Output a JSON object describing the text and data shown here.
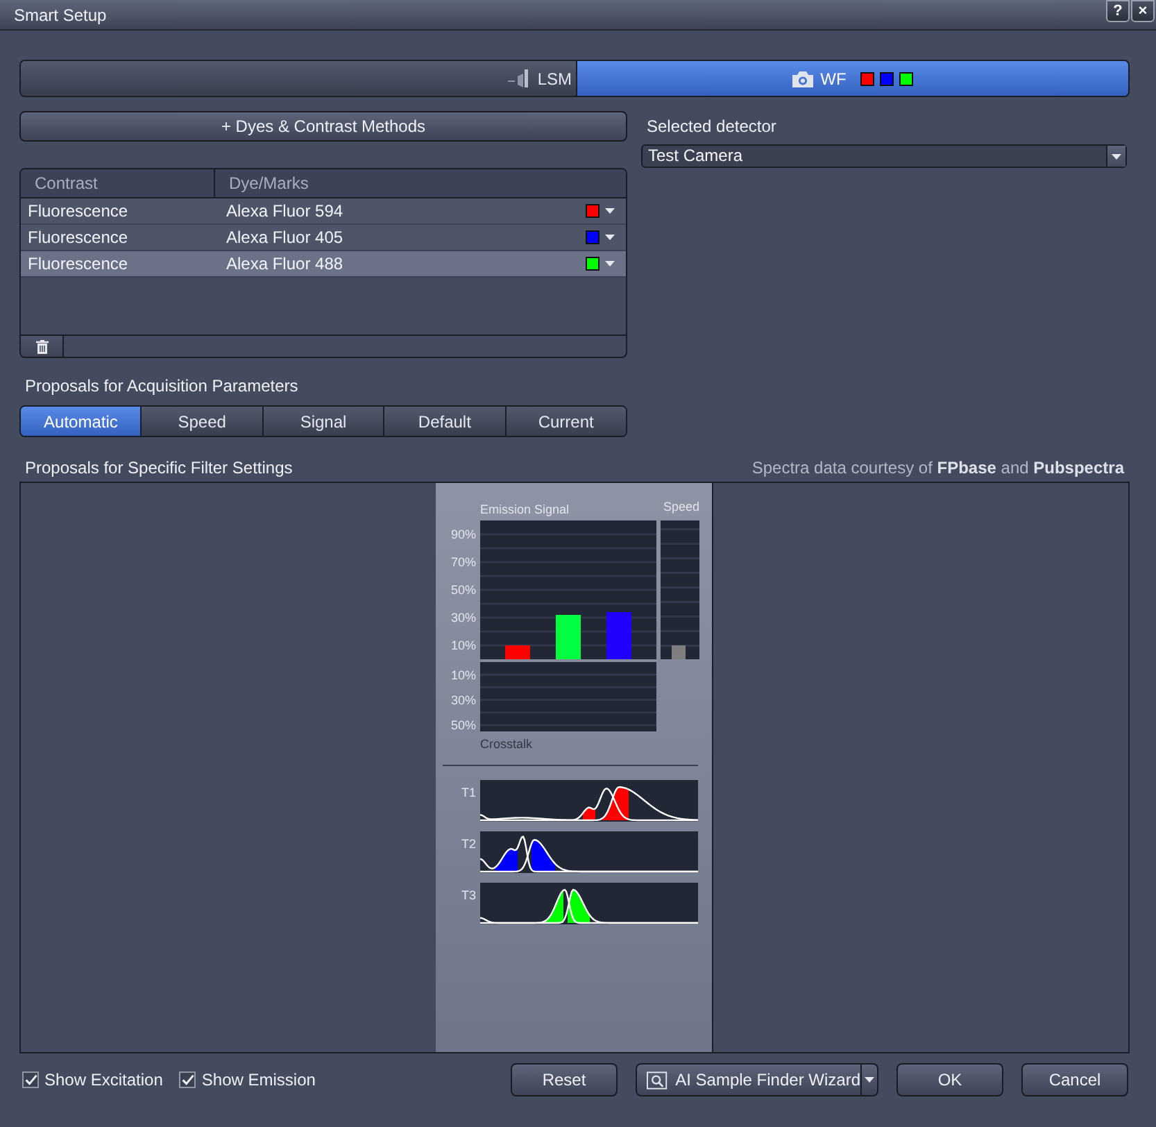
{
  "window": {
    "title": "Smart Setup",
    "title_buttons": [
      "?",
      "×"
    ]
  },
  "modes": [
    {
      "label": "LSM",
      "selected": false,
      "kind": "lsm"
    },
    {
      "label": "WF",
      "selected": true,
      "kind": "camera",
      "swatches": [
        {
          "color": "#ff0000"
        },
        {
          "color": "#0000ff"
        },
        {
          "color": "#00ff00"
        }
      ]
    }
  ],
  "add_button": {
    "label": "+ Dyes & Contrast Methods"
  },
  "detector": {
    "label": "Selected detector",
    "value": "Test Camera"
  },
  "dyes_table": {
    "columns": [
      "Contrast",
      "Dye/Marks"
    ],
    "rows": [
      {
        "contrast": "Fluorescence",
        "dye": "Alexa Fluor 594",
        "color": "#ff0000",
        "selected": false
      },
      {
        "contrast": "Fluorescence",
        "dye": "Alexa Fluor 405",
        "color": "#0000ff",
        "selected": false
      },
      {
        "contrast": "Fluorescence",
        "dye": "Alexa Fluor 488",
        "color": "#00ff00",
        "selected": true
      }
    ]
  },
  "acquisition": {
    "title": "Proposals for Acquisition Parameters",
    "options": [
      {
        "label": "Automatic",
        "selected": true
      },
      {
        "label": "Speed",
        "selected": false
      },
      {
        "label": "Signal",
        "selected": false
      },
      {
        "label": "Default",
        "selected": false
      },
      {
        "label": "Current",
        "selected": false
      }
    ]
  },
  "filter_settings": {
    "title": "Proposals for Specific Filter Settings",
    "credit": "Spectra data courtesy of **FPbase** and **Pubspectra**",
    "emission_chart": {
      "chart_data": {
        "type": "bar",
        "title": "Emission Signal",
        "categories": [
          null,
          null,
          null
        ],
        "grid": true,
        "ylim": [
          0,
          100
        ],
        "yticks": [
          {
            "value": 10,
            "label": "10%"
          },
          {
            "value": 30,
            "label": "30%"
          },
          {
            "value": 50,
            "label": "50%"
          },
          {
            "value": 70,
            "label": "70%"
          },
          {
            "value": 90,
            "label": "90%"
          }
        ],
        "series": [
          {
            "color": "#ff0000",
            "values": [
              10,
              null,
              null
            ]
          },
          {
            "color": "#00ff40",
            "values": [
              null,
              32,
              null
            ]
          },
          {
            "color": "#2000ff",
            "values": [
              null,
              null,
              34
            ]
          }
        ]
      }
    },
    "speed": {
      "label": "Speed",
      "level": 0.1
    },
    "crosstalk_chart": {
      "chart_data": {
        "type": "bar",
        "title": "Crosstalk",
        "categories": [
          null,
          null,
          null
        ],
        "grid": true,
        "ylim": [
          55,
          0
        ],
        "yticks": [
          {
            "value": 10,
            "label": "10%"
          },
          {
            "value": 30,
            "label": "30%"
          },
          {
            "value": 50,
            "label": "50%"
          }
        ]
      }
    },
    "spectra": [
      {
        "label": "T1",
        "color": "#ff0000"
      },
      {
        "label": "T2",
        "color": "#0000ff"
      },
      {
        "label": "T3",
        "color": "#00ff00"
      }
    ]
  },
  "footer": {
    "checkboxes": [
      {
        "label": "Show Excitation",
        "checked": true
      },
      {
        "label": "Show Emission",
        "checked": true
      }
    ],
    "buttons": [
      {
        "label": "Reset",
        "kind": "plain"
      },
      {
        "label": "AI Sample Finder Wizard",
        "kind": "split"
      },
      {
        "label": "OK",
        "kind": "plain"
      },
      {
        "label": "Cancel",
        "kind": "plain"
      }
    ]
  }
}
